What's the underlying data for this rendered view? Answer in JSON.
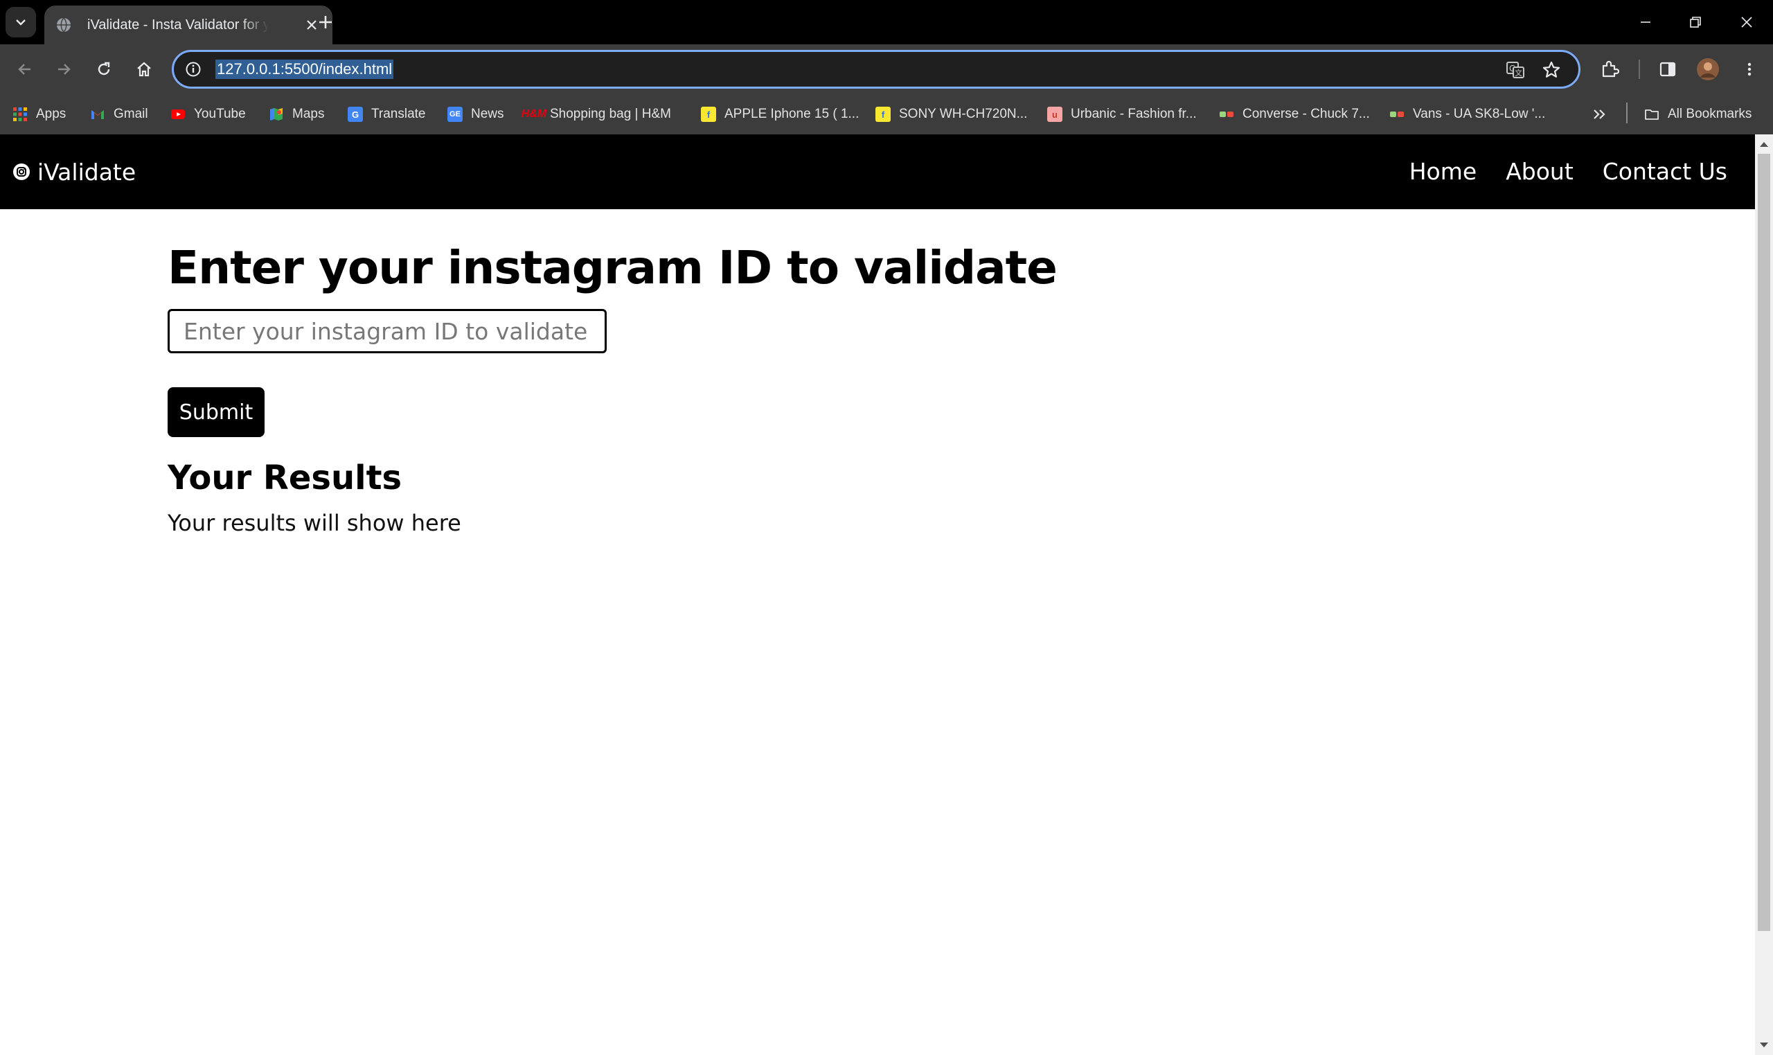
{
  "browser": {
    "tab": {
      "title": "iValidate - Insta Validator for your"
    },
    "address_bar": {
      "url": "127.0.0.1:5500/index.html"
    },
    "bookmarks": [
      {
        "label": "Apps",
        "icon": "apps-grid-icon"
      },
      {
        "label": "Gmail",
        "icon": "gmail-icon"
      },
      {
        "label": "YouTube",
        "icon": "youtube-icon"
      },
      {
        "label": "Maps",
        "icon": "maps-icon"
      },
      {
        "label": "Translate",
        "icon": "translate-icon"
      },
      {
        "label": "News",
        "icon": "news-icon"
      },
      {
        "label": "Shopping bag | H&M",
        "icon": "hm-icon"
      },
      {
        "label": "APPLE Iphone 15 ( 1...",
        "icon": "flipkart-icon"
      },
      {
        "label": "SONY WH-CH720N...",
        "icon": "flipkart-icon"
      },
      {
        "label": "Urbanic - Fashion fr...",
        "icon": "urbanic-icon"
      },
      {
        "label": "Converse - Chuck 7...",
        "icon": "store-icon"
      },
      {
        "label": "Vans - UA SK8-Low '...",
        "icon": "store-icon"
      }
    ],
    "all_bookmarks_label": "All Bookmarks",
    "accent_color": "#7cacf8"
  },
  "site": {
    "brand": "iValidate",
    "nav": {
      "home": "Home",
      "about": "About",
      "contact": "Contact Us"
    },
    "heading": "Enter your instagram ID to validate",
    "input": {
      "placeholder": "Enter your instagram ID to validate",
      "value": ""
    },
    "submit_label": "Submit",
    "results_heading": "Your Results",
    "results_text": "Your results will show here"
  }
}
